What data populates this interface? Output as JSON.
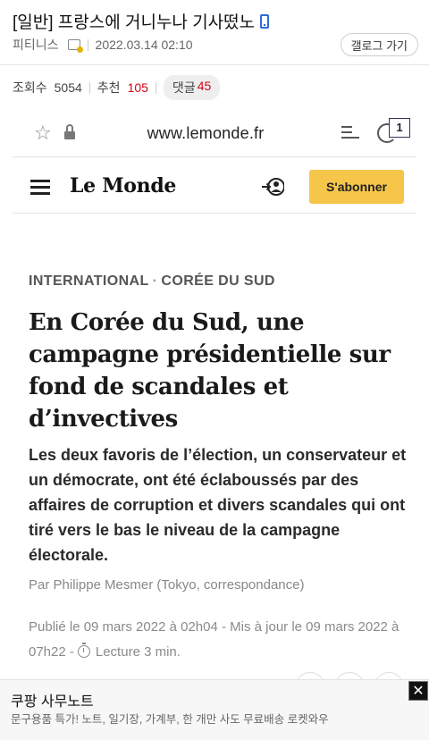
{
  "post": {
    "title": "[일반] 프랑스에 거니누나 기사떴노",
    "author": "피티니스",
    "timestamp": "2022.03.14 02:10",
    "gallery_button": "갤로그 가기",
    "views_label": "조회수",
    "views": "5054",
    "likes_label": "추천",
    "likes": "105",
    "comments_label": "댓글",
    "comments": "45"
  },
  "browser": {
    "url": "www.lemonde.fr",
    "tab_count": "1"
  },
  "lemonde": {
    "logo": "Le Monde",
    "subscribe_label": "S'abonner"
  },
  "article": {
    "section": "INTERNATIONAL",
    "subsection": "CORÉE DU SUD",
    "headline": "En Corée du Sud, une campagne présidentielle sur fond de scandales et d’invectives",
    "lede": "Les deux favoris de l’élection, un conservateur et un démocrate, ont été éclaboussés par des affaires de corruption et divers scandales qui ont tiré vers le bas le niveau de la campagne électorale.",
    "byline": "Par Philippe Mesmer (Tokyo, correspondance)",
    "published": "Publié le 09 mars 2022 à 02h04 - Mis à jour le 09 mars 2022 à 07h22 -",
    "reading_time": "Lecture 3 min."
  },
  "ad": {
    "title": "쿠팡 사무노트",
    "description": "문구용품 특가! 노트, 일기장, 가계부, 한 개만 사도 무료배송 로켓와우",
    "close_symbol": "✕"
  },
  "colors": {
    "accent_red": "#d0021b",
    "subscribe_yellow": "#f5c64a",
    "phone_blue": "#2f6bd8"
  },
  "icons": [
    "phone-icon",
    "author-badge-icon",
    "star-icon",
    "lock-icon",
    "reader-mode-icon",
    "tabs-icon",
    "hamburger-icon",
    "login-icon",
    "timer-icon",
    "close-icon"
  ]
}
